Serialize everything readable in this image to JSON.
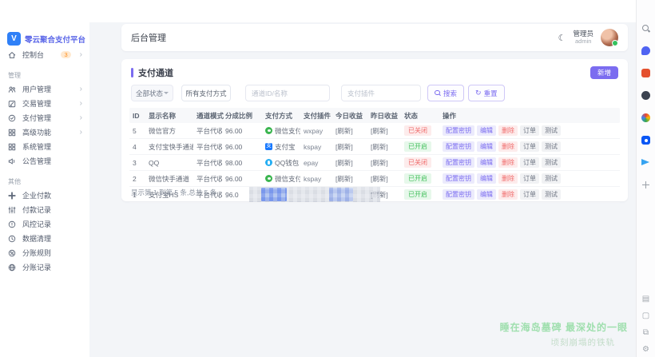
{
  "brand": {
    "name": "零云聚合支付平台",
    "logo_glyph": "V"
  },
  "topbar": {
    "title": "后台管理",
    "user": {
      "name": "管理员",
      "role": "admin"
    }
  },
  "sidebar": {
    "console": {
      "label": "控制台",
      "badge": "3"
    },
    "sections": [
      {
        "label": "管理",
        "items": [
          {
            "label": "用户管理"
          },
          {
            "label": "交易管理"
          },
          {
            "label": "支付管理"
          },
          {
            "label": "高级功能"
          },
          {
            "label": "系统管理"
          },
          {
            "label": "公告管理"
          }
        ]
      },
      {
        "label": "其他",
        "items": [
          {
            "label": "企业付款"
          },
          {
            "label": "付款记录"
          },
          {
            "label": "风控记录"
          },
          {
            "label": "数据清理"
          },
          {
            "label": "分账规则"
          },
          {
            "label": "分账记录"
          }
        ]
      }
    ]
  },
  "panel": {
    "title": "支付通道",
    "filters": {
      "status_select": "全部状态",
      "method_button": "所有支付方式",
      "id_placeholder": "通道ID/名称",
      "plugin_placeholder": "支付插件",
      "search_label": "搜索",
      "reset_label": "重置",
      "add_label": "新增"
    },
    "table": {
      "headers": [
        "ID",
        "显示名称",
        "通道模式",
        "分成比例",
        "支付方式",
        "支付插件",
        "今日收益",
        "昨日收益",
        "状态",
        "操作"
      ],
      "ops": [
        "配置密钥",
        "编辑",
        "删除",
        "订单",
        "测试"
      ],
      "rows": [
        {
          "id": "5",
          "name": "微信官方",
          "mode": "平台代收",
          "ratio": "96.00",
          "method": "微信支付",
          "plugin": "wxpay",
          "today": "[刷新]",
          "yesterday": "[刷新]",
          "status": "已关闭"
        },
        {
          "id": "4",
          "name": "支付宝快手通道",
          "mode": "平台代收",
          "ratio": "96.00",
          "method": "支付宝",
          "plugin": "kspay",
          "today": "[刷新]",
          "yesterday": "[刷新]",
          "status": "已开启"
        },
        {
          "id": "3",
          "name": "QQ",
          "mode": "平台代收",
          "ratio": "98.00",
          "method": "QQ钱包",
          "plugin": "epay",
          "today": "[刷新]",
          "yesterday": "[刷新]",
          "status": "已关闭"
        },
        {
          "id": "2",
          "name": "微信快手通道",
          "mode": "平台代收",
          "ratio": "96.00",
          "method": "微信支付",
          "plugin": "kspay",
          "today": "[刷新]",
          "yesterday": "[刷新]",
          "status": "已开启"
        },
        {
          "id": "1",
          "name": "支付宝HS",
          "mode": "平台代收",
          "ratio": "96.0",
          "method": "",
          "plugin": "",
          "today": "",
          "yesterday": "[刷新]",
          "status": "已开启"
        }
      ],
      "footer": "显示第 1 到第 5 条,总共 5 条"
    }
  },
  "watermark": {
    "line1": "睡在海岛墓碑 最深处的一眼",
    "line2": "顷刻崩塌的铁轨"
  },
  "icons": {
    "moon": "☾",
    "refresh": "↻",
    "chevron": "›",
    "alipay": "支",
    "image_tool": "▤",
    "window_tool": "▢",
    "copy_tool": "⧉",
    "gear_tool": "⚙"
  }
}
